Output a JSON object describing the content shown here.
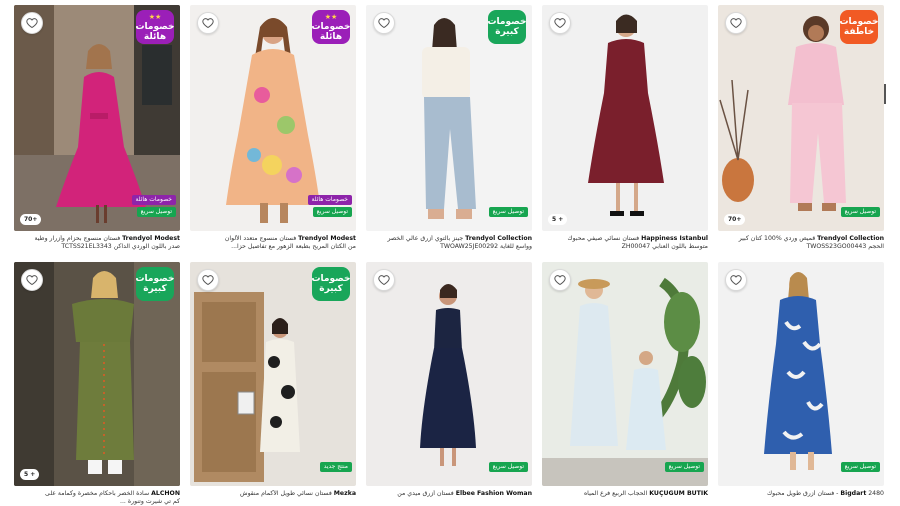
{
  "badges": {
    "big_discounts_line1": "خصومات",
    "big_discounts_line2": "هائلة",
    "big_discounts_stars": "★★",
    "big_ones_line1": "خصومات",
    "big_ones_line2": "كبيرة",
    "flash_line1": "خصومات",
    "flash_line2": "خاطفة",
    "fast_shipping": "توصيل سريع",
    "big_discounts_strip": "خصومات هائلة",
    "new": "منتج جديد"
  },
  "colors": {
    "purple_badge": "#9b1fb8",
    "green_badge": "#19a65a",
    "orange_badge": "#f15a24",
    "shipping": "#17a550"
  },
  "products": [
    {
      "brand": "Trendyol Modest",
      "name": "فستان منسوج بحزام وأزرار وطية",
      "sku": "صدر باللون الوردي الداكن TCTSS21EL3343",
      "rating": "70+",
      "badge": "هائلة"
    },
    {
      "brand": "Trendyol Modest",
      "name": "فستان منسوج متعدد الألوان",
      "sku": "من الكتان المريح بطبعة الزهور مع تفاصيل حزا...",
      "rating": "",
      "badge": "هائلة"
    },
    {
      "brand": "Trendyol Collection",
      "name": "جينز بالتوي أزرق عالي الخصر",
      "sku": "وواسع للغاية TWOAW25JE00292",
      "rating": "",
      "badge": "كبيرة"
    },
    {
      "brand": "Happiness İstanbul",
      "name": "فستان نسائي صيفي محبوك",
      "sku": "متوسط باللون العنابي ZH00047",
      "rating": "5 +",
      "badge": ""
    },
    {
      "brand": "Trendyol Collection",
      "name": "قميص وردي %100 كتان كبير",
      "sku": "الحجم TWOSS23GO00443",
      "rating": "70+",
      "badge": "خاطفة"
    },
    {
      "brand": "ALCHON",
      "name": "سادة الخصر بأحكام مخصرة وكمامة على",
      "sku": "كم تي شيرت وتنورة ...",
      "rating": "5 +",
      "badge": "كبيرة"
    },
    {
      "brand": "Mezka",
      "name": "فستان نسائي طويل الأكمام منقوش",
      "sku": "",
      "rating": "",
      "badge": ""
    },
    {
      "brand": "Elbee Fashion Woman",
      "name": "فستان أزرق ميدي من",
      "sku": "",
      "rating": "",
      "badge": ""
    },
    {
      "brand": "KÜÇÜGUM BUTİK",
      "name": "الحجاب الربيع فرع المياه",
      "sku": "",
      "rating": "",
      "badge": ""
    },
    {
      "brand": "Bigdart",
      "name": "2480 - فستان أزرق طويل محبوك",
      "sku": "",
      "rating": "",
      "badge": ""
    }
  ]
}
